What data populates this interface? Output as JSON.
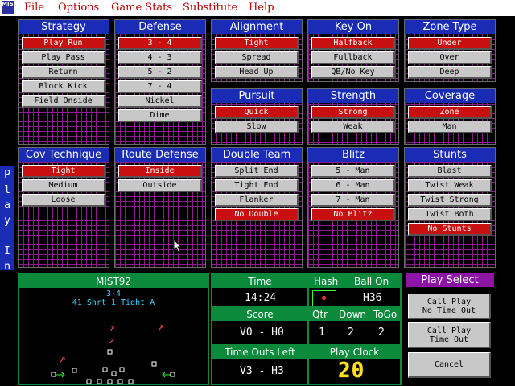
{
  "menu": {
    "logo": "MIST",
    "items": [
      "File",
      "Options",
      "Game Stats",
      "Substitute",
      "Help"
    ]
  },
  "panels": {
    "strategy": {
      "title": "Strategy",
      "options": [
        "Play Run",
        "Play Pass",
        "Return",
        "Block Kick",
        "Field Onside"
      ],
      "selected": 0
    },
    "defense": {
      "title": "Defense",
      "options": [
        "3 - 4",
        "4 - 3",
        "5 - 2",
        "7 - 4",
        "Nickel",
        "Dime"
      ],
      "selected": 0
    },
    "alignment": {
      "title": "Alignment",
      "options": [
        "Tight",
        "Spread",
        "Head Up"
      ],
      "selected": 0
    },
    "key_on": {
      "title": "Key On",
      "options": [
        "Halfback",
        "Fullback",
        "QB/No Key"
      ],
      "selected": 0
    },
    "zone_type": {
      "title": "Zone Type",
      "options": [
        "Under",
        "Over",
        "Deep"
      ],
      "selected": 0
    },
    "pursuit": {
      "title": "Pursuit",
      "options": [
        "Quick",
        "Slow"
      ],
      "selected": 0
    },
    "strength": {
      "title": "Strength",
      "options": [
        "Strong",
        "Weak"
      ],
      "selected": 0
    },
    "coverage": {
      "title": "Coverage",
      "options": [
        "Zone",
        "Man"
      ],
      "selected": 0
    },
    "cov_technique": {
      "title": "Cov Technique",
      "options": [
        "Tight",
        "Medium",
        "Loose"
      ],
      "selected": 0
    },
    "route_defense": {
      "title": "Route Defense",
      "options": [
        "Inside",
        "Outside"
      ],
      "selected": 0
    },
    "double_team": {
      "title": "Double Team",
      "options": [
        "Split End",
        "Tight End",
        "Flanker",
        "No Double"
      ],
      "selected": 3
    },
    "blitz": {
      "title": "Blitz",
      "options": [
        "5 - Man",
        "6 - Man",
        "7 - Man",
        "No Blitz"
      ],
      "selected": 3
    },
    "stunts": {
      "title": "Stunts",
      "options": [
        "Blast",
        "Twist Weak",
        "Twist Strong",
        "Twist Both",
        "No Stunts"
      ],
      "selected": 4
    }
  },
  "play_in": "Play In",
  "field": {
    "title": "MIST92",
    "formation": "3-4",
    "offense": "41 Shrt 1 Tight A"
  },
  "board": {
    "time_label": "Time",
    "time": "14:24",
    "hash_label": "Hash",
    "ball_on_label": "Ball On",
    "ball_on": "H36",
    "score_label": "Score",
    "score": "V0 - H0",
    "qtr_label": "Qtr",
    "down_label": "Down",
    "togo_label": "ToGo",
    "qtr": "1",
    "down": "2",
    "togo": "2",
    "timeouts_label": "Time Outs Left",
    "timeouts": "V3 - H3",
    "play_clock_label": "Play Clock",
    "play_clock": "20"
  },
  "play_select": {
    "title": "Play Select",
    "call_play_no_timeout": [
      "Call Play",
      "No Time Out"
    ],
    "call_play_timeout": [
      "Call Play",
      "Time Out"
    ],
    "cancel": "Cancel"
  },
  "colors": {
    "panel_title": "#1a2cb5",
    "selected": "#c81010",
    "grid": "#8f1a8f",
    "board_green": "#0a8a3a",
    "play_select": "#8c14a6"
  }
}
